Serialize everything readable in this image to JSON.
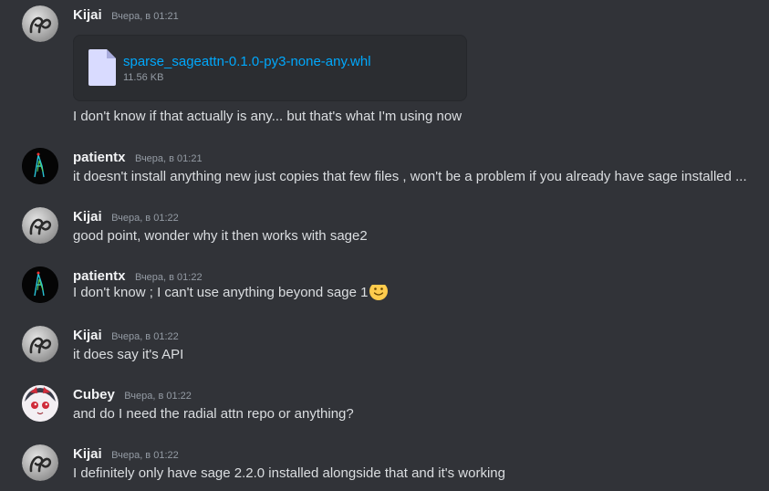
{
  "messages": [
    {
      "user": "Kijai",
      "avatar": "kijai-avatar",
      "time": "Вчера, в 01:21",
      "attachment": {
        "name": "sparse_sageattn-0.1.0-py3-none-any.whl",
        "size": "11.56 KB",
        "icon": "file-icon"
      },
      "text": "I don't know if that actually is any... but that's what I'm using now"
    },
    {
      "user": "patientx",
      "avatar": "patientx-avatar",
      "time": "Вчера, в 01:21",
      "text": "it doesn't install anything new just copies that few files , won't be a problem if you already have sage installed ..."
    },
    {
      "user": "Kijai",
      "avatar": "kijai-avatar",
      "time": "Вчера, в 01:22",
      "text": "good point, wonder why it then works with sage2"
    },
    {
      "user": "patientx",
      "avatar": "patientx-avatar",
      "time": "Вчера, в 01:22",
      "text": "I don't know ; I can't use anything beyond sage 1",
      "emoji": "slightly-smiling-face-emoji"
    },
    {
      "user": "Kijai",
      "avatar": "kijai-avatar",
      "time": "Вчера, в 01:22",
      "text": "it does say it's API"
    },
    {
      "user": "Cubey",
      "avatar": "cubey-avatar",
      "time": "Вчера, в 01:22",
      "text": "and do I need the radial attn repo or anything?"
    },
    {
      "user": "Kijai",
      "avatar": "kijai-avatar",
      "time": "Вчера, в 01:22",
      "text": "I definitely only have sage 2.2.0 installed alongside that and it's working"
    }
  ],
  "colors": {
    "background": "#313338",
    "username": "#f2f3f5",
    "text": "#dbdee1",
    "timestamp": "#949ba4",
    "link": "#00a8fc"
  }
}
